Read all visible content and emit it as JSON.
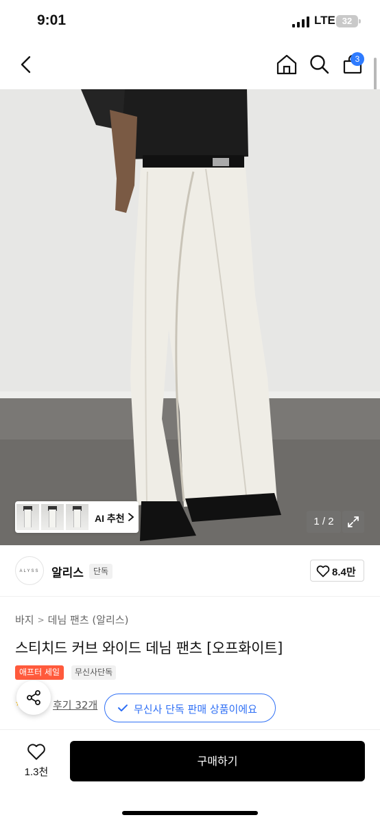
{
  "status_bar": {
    "time": "9:01",
    "network": "LTE",
    "battery": "32"
  },
  "nav": {
    "cart_count": "3"
  },
  "gallery": {
    "ai_label": "AI 추천",
    "page_indicator": "1 / 2"
  },
  "brand": {
    "logo_text": "ALYSS",
    "name": "알리스",
    "exclusive_tag": "단독",
    "likes": "8.4만"
  },
  "product": {
    "breadcrumb": [
      "바지",
      "데님 팬츠 (알리스)"
    ],
    "title": "스티치드 커브 와이드 데님 팬츠 [오프화이트]",
    "tags": {
      "sale": "애프터 세일",
      "exclusive": "무신사단독"
    },
    "reviews": "후기 32개",
    "exclusive_notice": "무신사 단독 판매 상품이에요"
  },
  "bottom_bar": {
    "wish_count": "1.3천",
    "buy_label": "구매하기"
  },
  "colors": {
    "accent_blue": "#2e6ff5",
    "sale_red": "#ff5a3c",
    "buy_button": "#000000"
  }
}
